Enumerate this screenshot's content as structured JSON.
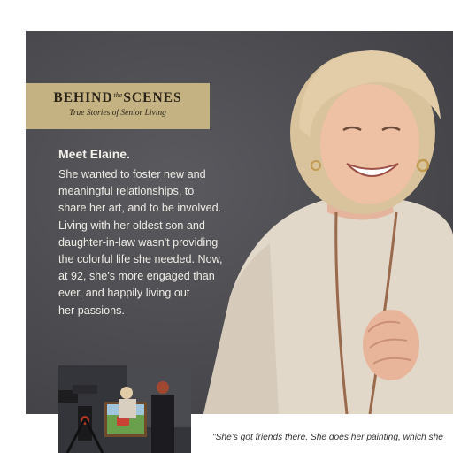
{
  "banner": {
    "title_left": "BEHIND",
    "title_the": "the",
    "title_right": "SCENES",
    "subtitle": "True Stories of Senior Living"
  },
  "story": {
    "heading": "Meet Elaine.",
    "lines": [
      "She wanted to foster new and",
      "meaningful relationships, to",
      "share her art, and to be involved.",
      "Living with her oldest son and",
      "daughter-in-law wasn't providing",
      "the colorful life she needed. Now,",
      "at 92, she's more engaged than",
      "ever, and happily living out",
      "her passions."
    ]
  },
  "quote": {
    "line1": "\"She's got friends there. She does her painting, which she"
  },
  "colors": {
    "banner": "#c4b282",
    "hero_bg": "#4a4a4f",
    "text_light": "#efece4"
  }
}
